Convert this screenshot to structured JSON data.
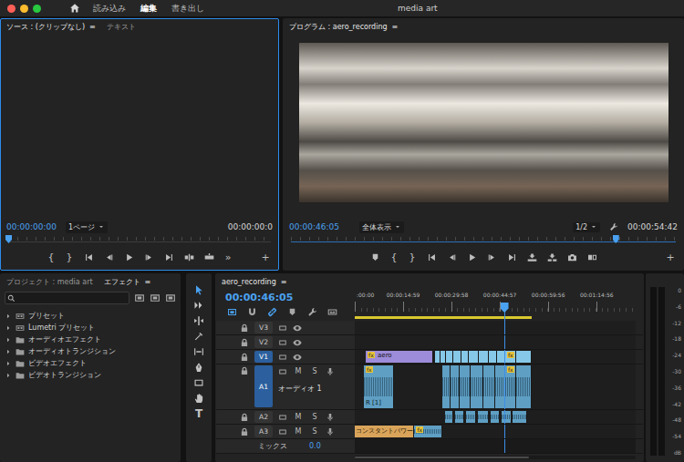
{
  "window": {
    "title": "media art"
  },
  "workspaces": [
    {
      "label": "読み込み",
      "selected": false
    },
    {
      "label": "編集",
      "selected": true
    },
    {
      "label": "書き出し",
      "selected": false
    }
  ],
  "source_panel": {
    "active": true,
    "tabs": [
      {
        "label": "ソース : (クリップなし)",
        "selected": true,
        "menu": "≡"
      },
      {
        "label": "テキスト",
        "selected": false
      }
    ],
    "timecode": "00:00:00:00",
    "page_select": "1ページ",
    "duration": "00:00:00:0",
    "playhead_level": 0,
    "marks": [
      "{",
      "}"
    ],
    "more": "»",
    "add": "+"
  },
  "program_panel": {
    "active": false,
    "tabs": [
      {
        "label": "プログラム : aero_recording",
        "selected": true,
        "menu": "≡"
      }
    ],
    "timecode": "00:00:46:05",
    "zoom": "全体表示",
    "resolution": "1/2",
    "duration": "00:00:54:42",
    "playhead_level": 0.843,
    "marks": [
      "{",
      "}"
    ],
    "add": "+"
  },
  "effects_panel": {
    "tabs": [
      {
        "label": "プロジェクト : media art",
        "selected": false
      },
      {
        "label": "エフェクト",
        "selected": true,
        "menu": "≡"
      }
    ],
    "items": [
      {
        "label": "プリセット",
        "kind": "preset",
        "expanded": false
      },
      {
        "label": "Lumetri プリセット",
        "kind": "preset",
        "expanded": false
      },
      {
        "label": "オーディオエフェクト",
        "kind": "folder",
        "expanded": false
      },
      {
        "label": "オーディオトランジション",
        "kind": "folder",
        "expanded": false
      },
      {
        "label": "ビデオエフェクト",
        "kind": "folder",
        "expanded": false
      },
      {
        "label": "ビデオトランジション",
        "kind": "folder",
        "expanded": false
      }
    ]
  },
  "tools": [
    {
      "selected": true
    },
    {
      "selected": false
    },
    {
      "selected": false
    },
    {
      "selected": false
    },
    {
      "selected": false
    },
    {
      "selected": false
    },
    {
      "selected": false
    },
    {
      "selected": false
    },
    {
      "selected": false,
      "glyph": "T"
    }
  ],
  "timeline": {
    "tab": {
      "label": "aero_recording",
      "menu": "≡",
      "selected": true
    },
    "timecode": "00:00:46:05",
    "tools": [
      {
        "on": true
      },
      {
        "on": false
      },
      {
        "on": true
      },
      {
        "on": false
      },
      {
        "on": false
      },
      {
        "on": false
      }
    ],
    "ruler": [
      {
        "label": ":00:00",
        "seconds": 0
      },
      {
        "label": "00:00:14:59",
        "seconds": 14.98
      },
      {
        "label": "00:00:29:58",
        "seconds": 29.97
      },
      {
        "label": "00:00:44:57",
        "seconds": 44.95
      },
      {
        "label": "00:00:59:56",
        "seconds": 59.93
      },
      {
        "label": "00:01:14:56",
        "seconds": 74.93
      }
    ],
    "playhead_seconds": 46.2,
    "work_area": {
      "start": 0,
      "end": 54.7
    },
    "fx_label": "fx",
    "tracks": [
      {
        "name": "V3",
        "kind": "video",
        "targeted": false,
        "expanded": false,
        "clips": []
      },
      {
        "name": "V2",
        "kind": "video",
        "targeted": false,
        "expanded": false,
        "clips": []
      },
      {
        "name": "V1",
        "kind": "video",
        "targeted": true,
        "expanded": false,
        "clips": [
          {
            "start": 3.4,
            "end": 24.4,
            "kind": "video",
            "color": "#9d8cd9",
            "fx": true,
            "label": "aero"
          },
          {
            "start": 24.9,
            "end": 26.5,
            "kind": "video",
            "color": "#86c8e8",
            "fx": false
          },
          {
            "start": 26.5,
            "end": 28.2,
            "kind": "video",
            "color": "#86c8e8",
            "fx": false
          },
          {
            "start": 28.2,
            "end": 30.6,
            "kind": "video",
            "color": "#86c8e8",
            "fx": false
          },
          {
            "start": 30.6,
            "end": 33.1,
            "kind": "video",
            "color": "#86c8e8",
            "fx": false
          },
          {
            "start": 33.1,
            "end": 35.2,
            "kind": "video",
            "color": "#86c8e8",
            "fx": false
          },
          {
            "start": 35.2,
            "end": 38.4,
            "kind": "video",
            "color": "#86c8e8",
            "fx": false
          },
          {
            "start": 38.4,
            "end": 41.5,
            "kind": "video",
            "color": "#86c8e8",
            "fx": false
          },
          {
            "start": 41.5,
            "end": 44.2,
            "kind": "video",
            "color": "#86c8e8",
            "fx": false
          },
          {
            "start": 44.2,
            "end": 46.6,
            "kind": "video",
            "color": "#86c8e8",
            "fx": false
          },
          {
            "start": 46.6,
            "end": 50.1,
            "kind": "video",
            "color": "#86c8e8",
            "fx": true
          },
          {
            "start": 50.1,
            "end": 54.7,
            "kind": "video",
            "color": "#86c8e8",
            "fx": false
          }
        ]
      },
      {
        "name": "A1",
        "kind": "audio",
        "targeted": true,
        "expanded": true,
        "title": "オーディオ 1",
        "buttons": [
          "M",
          "S"
        ],
        "clips": [
          {
            "start": 2.8,
            "end": 12.2,
            "kind": "audio",
            "color": "#5f9fc4",
            "fx": true,
            "label": "R [1]"
          },
          {
            "start": 27.2,
            "end": 29.6,
            "kind": "audio",
            "color": "#5f9fc4",
            "fx": false
          },
          {
            "start": 29.6,
            "end": 32.4,
            "kind": "audio",
            "color": "#5f9fc4",
            "fx": false
          },
          {
            "start": 32.4,
            "end": 35.8,
            "kind": "audio",
            "color": "#5f9fc4",
            "fx": false
          },
          {
            "start": 35.8,
            "end": 39.8,
            "kind": "audio",
            "color": "#5f9fc4",
            "fx": false
          },
          {
            "start": 39.8,
            "end": 43.5,
            "kind": "audio",
            "color": "#5f9fc4",
            "fx": false
          },
          {
            "start": 43.5,
            "end": 46.6,
            "kind": "audio",
            "color": "#5f9fc4",
            "fx": false
          },
          {
            "start": 46.6,
            "end": 50.1,
            "kind": "audio",
            "color": "#5f9fc4",
            "fx": true
          },
          {
            "start": 50.1,
            "end": 54.7,
            "kind": "audio",
            "color": "#5f9fc4",
            "fx": false
          }
        ]
      },
      {
        "name": "A2",
        "kind": "audio",
        "targeted": false,
        "expanded": false,
        "buttons": [
          "M",
          "S"
        ],
        "clips": [
          {
            "start": 28.0,
            "end": 30.5,
            "kind": "audio",
            "color": "#5f9fc4",
            "fx": false
          },
          {
            "start": 31.0,
            "end": 33.8,
            "kind": "audio",
            "color": "#5f9fc4",
            "fx": false
          },
          {
            "start": 34.5,
            "end": 37.5,
            "kind": "audio",
            "color": "#5f9fc4",
            "fx": false
          },
          {
            "start": 38.0,
            "end": 41.5,
            "kind": "audio",
            "color": "#5f9fc4",
            "fx": false
          },
          {
            "start": 42.0,
            "end": 45.0,
            "kind": "audio",
            "color": "#5f9fc4",
            "fx": false
          },
          {
            "start": 45.5,
            "end": 48.6,
            "kind": "audio",
            "color": "#5f9fc4",
            "fx": false
          },
          {
            "start": 49.0,
            "end": 53.5,
            "kind": "audio",
            "color": "#5f9fc4",
            "fx": false
          }
        ]
      },
      {
        "name": "A3",
        "kind": "audio",
        "targeted": false,
        "expanded": false,
        "buttons": [
          "M",
          "S"
        ],
        "clips": [
          {
            "start": 18.5,
            "end": 27.2,
            "kind": "audio",
            "color": "#5f9fc4",
            "fx": true
          },
          {
            "start": 0,
            "end": 18.5,
            "kind": "transition",
            "color": "#d9a45a",
            "fx": false,
            "label": "コンスタントパワー"
          }
        ]
      }
    ],
    "mix": {
      "label": "ミックス",
      "value": "0.0"
    }
  },
  "meters": {
    "channels": [
      {
        "level": 0
      },
      {
        "level": 0
      }
    ],
    "scale": [
      "0",
      "-6",
      "-12",
      "-18",
      "-24",
      "-30",
      "-36",
      "-42",
      "-48",
      "-54",
      "dB"
    ]
  }
}
